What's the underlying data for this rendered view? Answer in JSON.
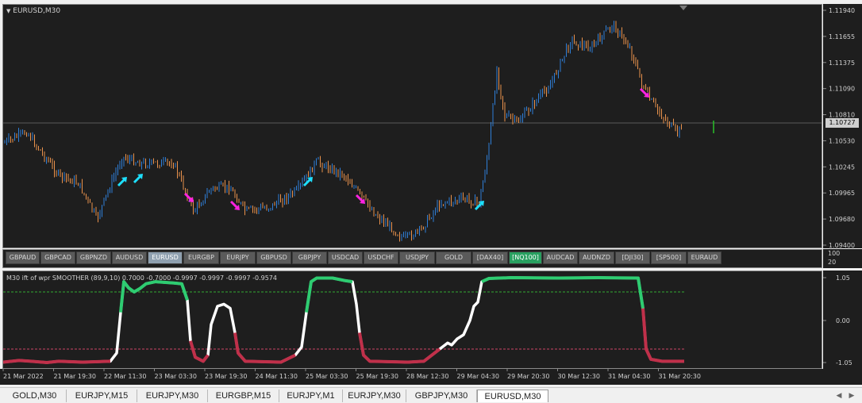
{
  "chart": {
    "title": "EURUSD,M30",
    "current_price": "1.10727",
    "price_ticks": [
      "1.11940",
      "1.11655",
      "1.11375",
      "1.11090",
      "1.10810",
      "1.10530",
      "1.10245",
      "1.09965",
      "1.09680",
      "1.09400"
    ],
    "colors": {
      "bull": "#2f7fd8",
      "bear": "#e8914c",
      "up_arrow": "#1ee0ff",
      "down_arrow": "#ff22e0",
      "price_line": "#5a5a5a",
      "current_tag": "#cfcfcf"
    }
  },
  "symbol_strip": {
    "scale_labels": [
      "100",
      "20"
    ],
    "buttons": [
      {
        "label": "GBPAUD",
        "state": "normal"
      },
      {
        "label": "GBPCAD",
        "state": "normal"
      },
      {
        "label": "GBPNZD",
        "state": "normal"
      },
      {
        "label": "AUDUSD",
        "state": "normal"
      },
      {
        "label": "EURUSD",
        "state": "active"
      },
      {
        "label": "EURGBP",
        "state": "normal"
      },
      {
        "label": "EURJPY",
        "state": "normal"
      },
      {
        "label": "GBPUSD",
        "state": "normal"
      },
      {
        "label": "GBPJPY",
        "state": "normal"
      },
      {
        "label": "USDCAD",
        "state": "normal"
      },
      {
        "label": "USDCHF",
        "state": "normal"
      },
      {
        "label": "USDJPY",
        "state": "normal"
      },
      {
        "label": "GOLD",
        "state": "normal"
      },
      {
        "label": "[DAX40]",
        "state": "normal"
      },
      {
        "label": "[NQ100]",
        "state": "highlighted"
      },
      {
        "label": "AUDCAD",
        "state": "normal"
      },
      {
        "label": "AUDNZD",
        "state": "normal"
      },
      {
        "label": "[DJI30]",
        "state": "normal"
      },
      {
        "label": "[SP500]",
        "state": "normal"
      },
      {
        "label": "EURAUD",
        "state": "normal"
      }
    ]
  },
  "indicator": {
    "label": "M30 ift of wpr SMOOTHER (89,9,10) 0.7000 -0.7000 -0.9997 -0.9997 -0.9997 -0.9574",
    "scale_ticks": [
      "1.05",
      "0.00",
      "-1.05"
    ],
    "levels": {
      "upper": 0.7,
      "lower": -0.7
    },
    "colors": {
      "line": "#ffffff",
      "overbought": "#2ecc71",
      "oversold": "#c0304a",
      "upper_level": "#33aa33",
      "lower_level": "#cc4466"
    }
  },
  "time_axis": {
    "labels": [
      "21 Mar 2022",
      "21 Mar 19:30",
      "22 Mar 11:30",
      "23 Mar 03:30",
      "23 Mar 19:30",
      "24 Mar 11:30",
      "25 Mar 03:30",
      "25 Mar 19:30",
      "28 Mar 12:30",
      "29 Mar 04:30",
      "29 Mar 20:30",
      "30 Mar 12:30",
      "31 Mar 04:30",
      "31 Mar 20:30"
    ]
  },
  "tabs": [
    {
      "label": "GOLD,M30",
      "active": false
    },
    {
      "label": "EURJPY,M15",
      "active": false
    },
    {
      "label": "EURJPY,M30",
      "active": false
    },
    {
      "label": "EURGBP,M15",
      "active": false
    },
    {
      "label": "EURJPY,M1",
      "active": false
    },
    {
      "label": "EURJPY,M30",
      "active": false
    },
    {
      "label": "GBPJPY,M30",
      "active": false
    },
    {
      "label": "EURUSD,M30",
      "active": true
    }
  ],
  "tab_nav": {
    "left": "◀",
    "right": "▶"
  }
}
